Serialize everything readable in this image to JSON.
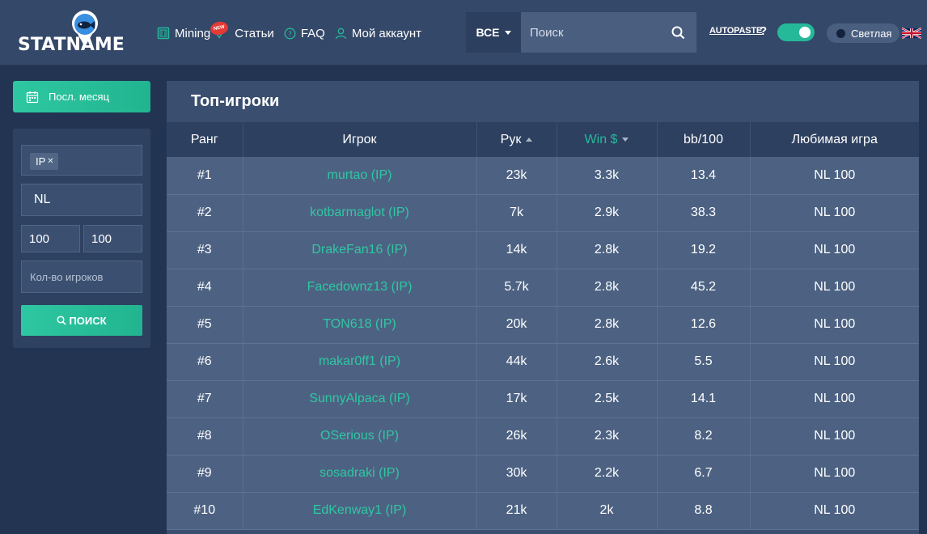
{
  "header": {
    "logo_text": "STATNAME",
    "nav": [
      {
        "label": "Mining",
        "badge": "NEW"
      },
      {
        "label": "Статьи"
      },
      {
        "label": "FAQ"
      },
      {
        "label": "Мой аккаунт"
      }
    ],
    "scope_label": "ВСЕ",
    "search_placeholder": "Поиск",
    "autopaste_label": "AUTOPASTE",
    "autopaste_help": "?",
    "autopaste_enabled": true,
    "theme_label": "Светлая",
    "language": "en-GB"
  },
  "sidebar": {
    "period_label": "Посл. месяц",
    "site_tag": "IP",
    "game_value": "NL",
    "limit_from": "100",
    "limit_to": "100",
    "players_count_placeholder": "Кол-во игроков",
    "search_button": "ПОИСК"
  },
  "main": {
    "title": "Топ-игроки",
    "columns": [
      "Ранг",
      "Игрок",
      "Рук",
      "Win $",
      "bb/100",
      "Любимая игра"
    ],
    "rows": [
      {
        "rank": "#1",
        "player": "murtao (IP)",
        "hands": "23k",
        "win": "3.3k",
        "bb100": "13.4",
        "game": "NL 100"
      },
      {
        "rank": "#2",
        "player": "kotbarmaglot (IP)",
        "hands": "7k",
        "win": "2.9k",
        "bb100": "38.3",
        "game": "NL 100"
      },
      {
        "rank": "#3",
        "player": "DrakeFan16 (IP)",
        "hands": "14k",
        "win": "2.8k",
        "bb100": "19.2",
        "game": "NL 100"
      },
      {
        "rank": "#4",
        "player": "Facedownz13 (IP)",
        "hands": "5.7k",
        "win": "2.8k",
        "bb100": "45.2",
        "game": "NL 100"
      },
      {
        "rank": "#5",
        "player": "TON618 (IP)",
        "hands": "20k",
        "win": "2.8k",
        "bb100": "12.6",
        "game": "NL 100"
      },
      {
        "rank": "#6",
        "player": "makar0ff1 (IP)",
        "hands": "44k",
        "win": "2.6k",
        "bb100": "5.5",
        "game": "NL 100"
      },
      {
        "rank": "#7",
        "player": "SunnyAlpaca (IP)",
        "hands": "17k",
        "win": "2.5k",
        "bb100": "14.1",
        "game": "NL 100"
      },
      {
        "rank": "#8",
        "player": "OSerious (IP)",
        "hands": "26k",
        "win": "2.3k",
        "bb100": "8.2",
        "game": "NL 100"
      },
      {
        "rank": "#9",
        "player": "sosadraki (IP)",
        "hands": "30k",
        "win": "2.2k",
        "bb100": "6.7",
        "game": "NL 100"
      },
      {
        "rank": "#10",
        "player": "EdKenway1 (IP)",
        "hands": "21k",
        "win": "2k",
        "bb100": "8.8",
        "game": "NL 100"
      }
    ]
  },
  "colors": {
    "accent": "#25b99a",
    "header_bg": "#344869",
    "page_bg": "#223452",
    "row_bg": "#4d6282"
  }
}
